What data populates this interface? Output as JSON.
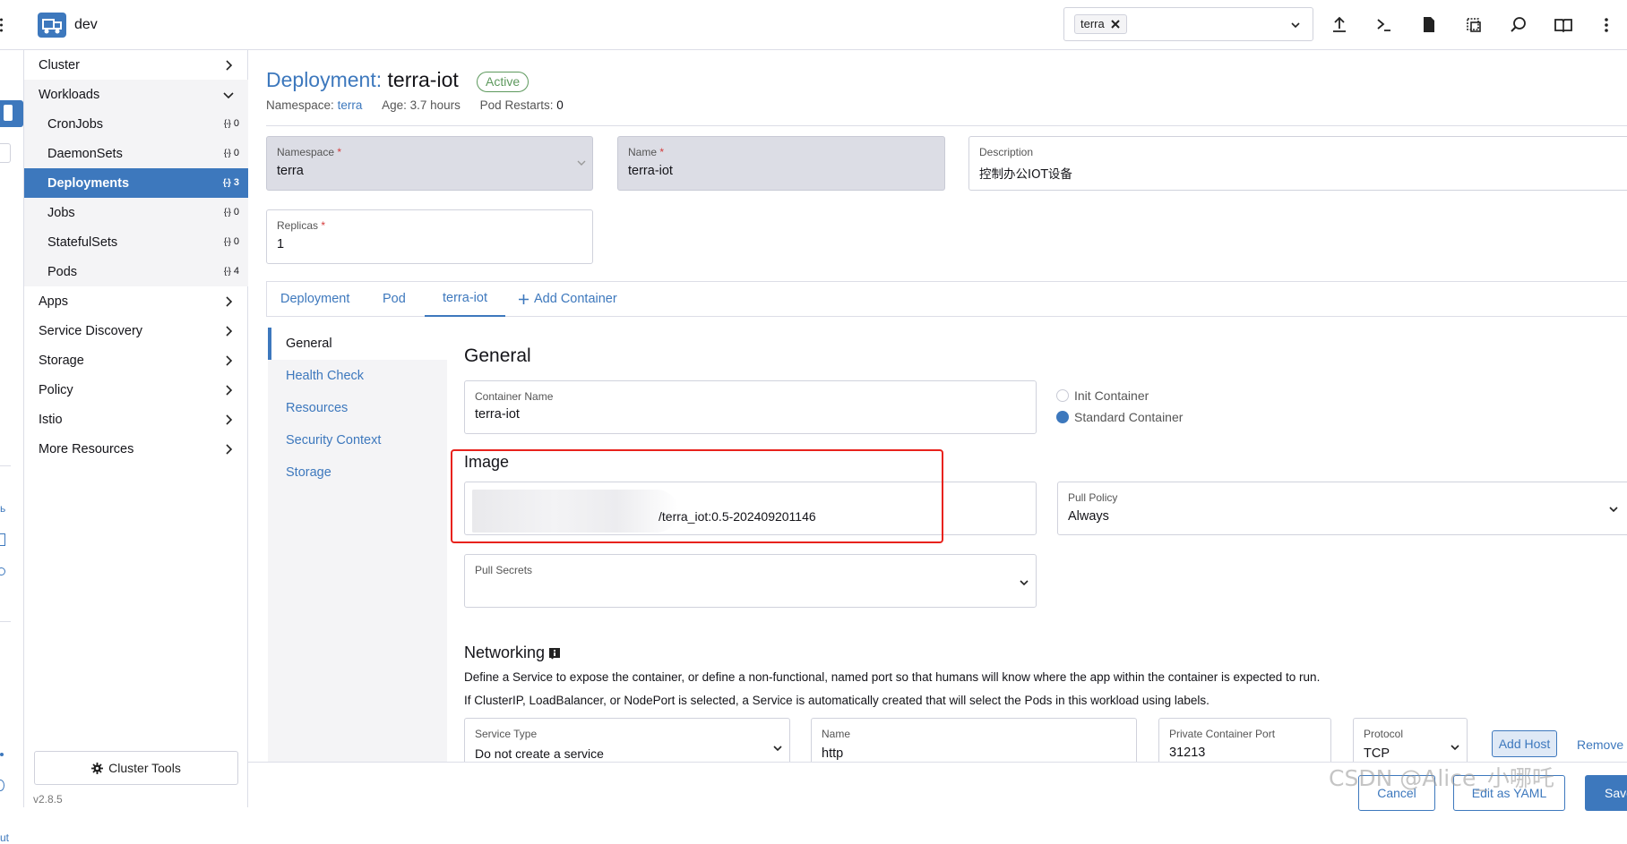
{
  "header": {
    "cluster_name": "dev",
    "namespace_chip": "terra"
  },
  "sidebar": {
    "groups": [
      {
        "label": "Cluster"
      },
      {
        "label": "Workloads"
      },
      {
        "label": "Apps"
      },
      {
        "label": "Service Discovery"
      },
      {
        "label": "Storage"
      },
      {
        "label": "Policy"
      },
      {
        "label": "Istio"
      },
      {
        "label": "More Resources"
      }
    ],
    "workloads": [
      {
        "label": "CronJobs",
        "count": "0"
      },
      {
        "label": "DaemonSets",
        "count": "0"
      },
      {
        "label": "Deployments",
        "count": "3"
      },
      {
        "label": "Jobs",
        "count": "0"
      },
      {
        "label": "StatefulSets",
        "count": "0"
      },
      {
        "label": "Pods",
        "count": "4"
      }
    ],
    "cluster_tools": "Cluster Tools",
    "version": "v2.8.5"
  },
  "page": {
    "title_prefix": "Deployment:",
    "title_name": "terra-iot",
    "status": "Active",
    "namespace_label": "Namespace:",
    "namespace_value": "terra",
    "age": "Age: 3.7 hours",
    "restarts_label": "Pod Restarts:",
    "restarts_value": "0"
  },
  "form": {
    "namespace": {
      "label": "Namespace",
      "value": "terra"
    },
    "name": {
      "label": "Name",
      "value": "terra-iot"
    },
    "description": {
      "label": "Description",
      "value": "控制办公IOT设备"
    },
    "replicas": {
      "label": "Replicas",
      "value": "1"
    }
  },
  "tabs": [
    "Deployment",
    "Pod",
    "terra-iot",
    "Add Container"
  ],
  "side_tabs": [
    "General",
    "Health Check",
    "Resources",
    "Security Context",
    "Storage"
  ],
  "general": {
    "heading": "General",
    "container_name_label": "Container Name",
    "container_name_value": "terra-iot",
    "init_container": "Init Container",
    "standard_container": "Standard Container",
    "image_heading": "Image",
    "container_image_value": "/terra_iot:0.5-202409201146",
    "pull_policy_label": "Pull Policy",
    "pull_policy_value": "Always",
    "pull_secrets_label": "Pull Secrets"
  },
  "networking": {
    "heading": "Networking",
    "desc1": "Define a Service to expose the container, or define a non-functional, named port so that humans will know where the app within the container is expected to run.",
    "desc2": "If ClusterIP, LoadBalancer, or NodePort is selected, a Service is automatically created that will select the Pods in this workload using labels.",
    "service_type_label": "Service Type",
    "service_type_value": "Do not create a service",
    "name_label": "Name",
    "name_value": "http",
    "port_label": "Private Container Port",
    "port_value": "31213",
    "protocol_label": "Protocol",
    "protocol_value": "TCP",
    "add_host": "Add Host",
    "remove": "Remove"
  },
  "footer": {
    "cancel": "Cancel",
    "edit_yaml": "Edit as YAML",
    "save": "Save"
  },
  "watermark": "CSDN @Alice_小哪吒",
  "colors": {
    "accent": "#3d78bd",
    "active_badge": "#5d995d",
    "highlight_box": "#e8221c"
  }
}
